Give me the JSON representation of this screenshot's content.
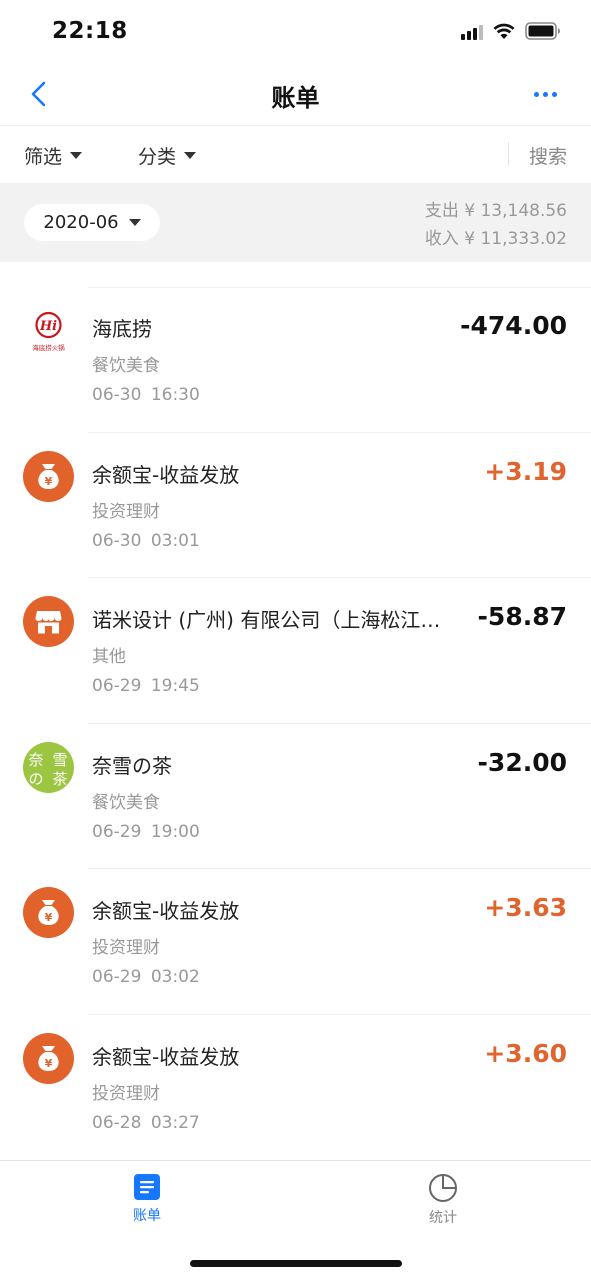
{
  "status_bar": {
    "time": "22:18"
  },
  "nav": {
    "title": "账单",
    "back_icon": "chevron-left-icon",
    "more_icon": "ellipsis-icon",
    "accent_color": "#1677ff"
  },
  "filters": {
    "filter_label": "筛选",
    "category_label": "分类",
    "search_label": "搜索"
  },
  "month": {
    "selected": "2020-06",
    "expense_text": "支出 ¥ 13,148.56",
    "income_text": "收入 ¥ 11,333.02"
  },
  "transactions": [
    {
      "name": "海底捞",
      "category": "餐饮美食",
      "date": "06-30",
      "time": "16:30",
      "amount": "-474.00",
      "type": "expense",
      "icon": "haidilao-logo-icon"
    },
    {
      "name": "余额宝-收益发放",
      "category": "投资理财",
      "date": "06-30",
      "time": "03:01",
      "amount": "+3.19",
      "type": "income",
      "icon": "money-bag-icon"
    },
    {
      "name": "诺米设计 (广州) 有限公司（上海松江…",
      "category": "其他",
      "date": "06-29",
      "time": "19:45",
      "amount": "-58.87",
      "type": "expense",
      "icon": "shop-icon"
    },
    {
      "name": "奈雪の茶",
      "category": "餐饮美食",
      "date": "06-29",
      "time": "19:00",
      "amount": "-32.00",
      "type": "expense",
      "icon": "nayuki-logo-icon"
    },
    {
      "name": "余额宝-收益发放",
      "category": "投资理财",
      "date": "06-29",
      "time": "03:02",
      "amount": "+3.63",
      "type": "income",
      "icon": "money-bag-icon"
    },
    {
      "name": "余额宝-收益发放",
      "category": "投资理财",
      "date": "06-28",
      "time": "03:27",
      "amount": "+3.60",
      "type": "income",
      "icon": "money-bag-icon"
    }
  ],
  "tabs": [
    {
      "label": "账单",
      "icon": "bill-icon",
      "active": true
    },
    {
      "label": "统计",
      "icon": "pie-chart-icon",
      "active": false
    }
  ],
  "colors": {
    "income": "#e0642d",
    "expense": "#111111",
    "icon_orange": "#e2622c",
    "nayuki_green": "#9cc642"
  },
  "logos": {
    "haidilao": "海底捞火锅",
    "nayuki": "奈雪の茶"
  }
}
